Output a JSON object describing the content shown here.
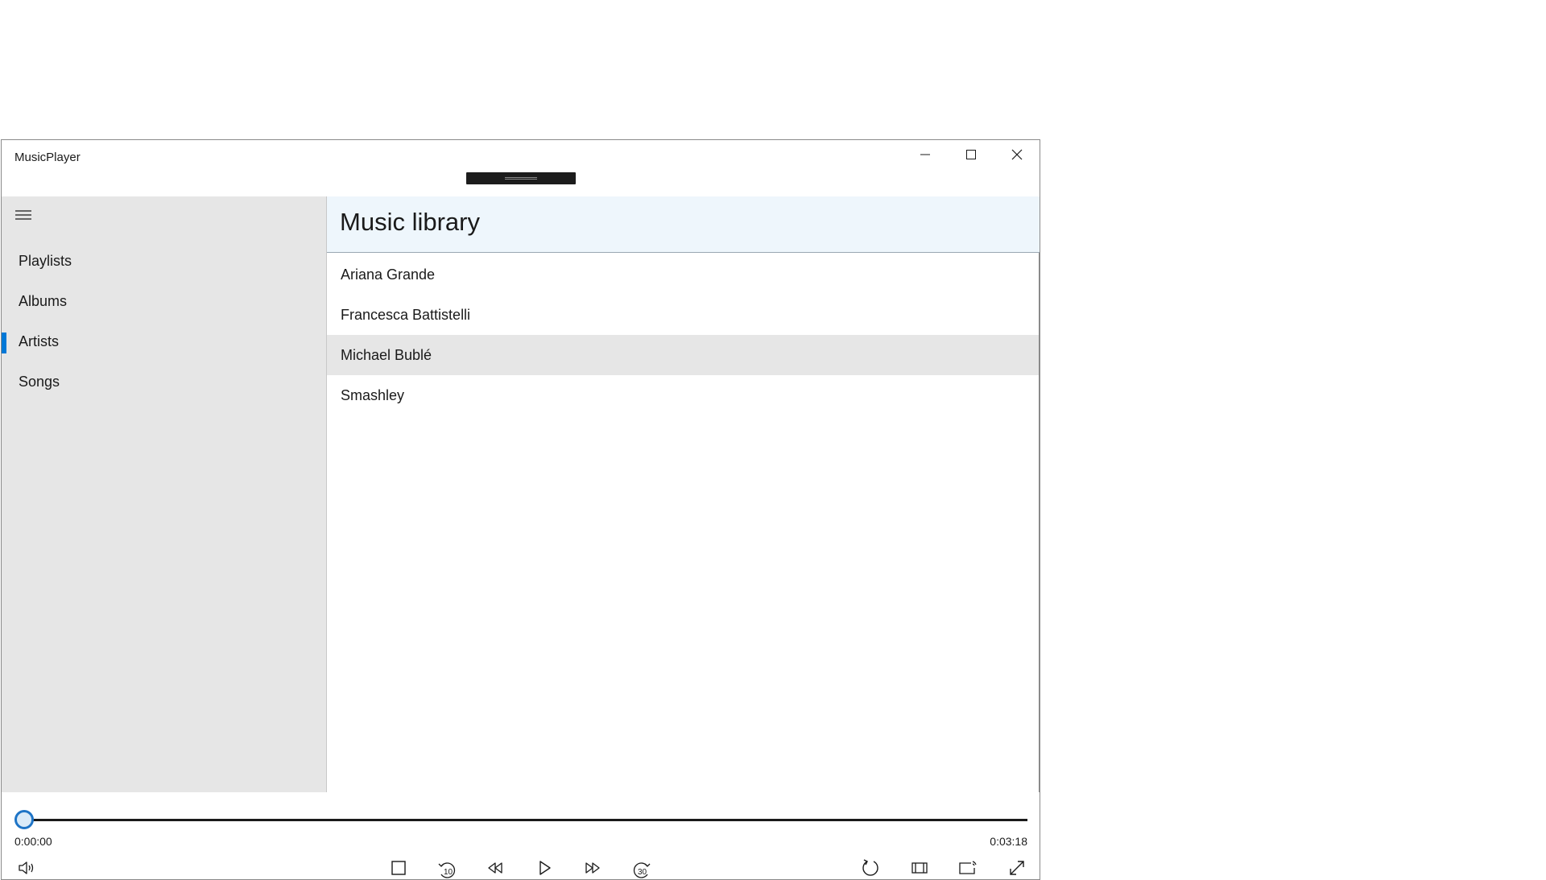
{
  "window": {
    "title": "MusicPlayer"
  },
  "titlebar": {
    "buttons": [
      "minimize-icon",
      "maximize-icon",
      "close-icon"
    ]
  },
  "sidebar": {
    "menu_icon": "hamburger-icon",
    "items": [
      {
        "label": "Playlists",
        "selected": false
      },
      {
        "label": "Albums",
        "selected": false
      },
      {
        "label": "Artists",
        "selected": true
      },
      {
        "label": "Songs",
        "selected": false
      }
    ],
    "accent_color": "#0078d7"
  },
  "main": {
    "title": "Music library",
    "list": [
      {
        "label": "Ariana Grande",
        "hover": false
      },
      {
        "label": "Francesca Battistelli",
        "hover": false
      },
      {
        "label": "Michael Bublé",
        "hover": true
      },
      {
        "label": "Smashley",
        "hover": false
      }
    ]
  },
  "player": {
    "position": "0:00:00",
    "duration": "0:03:18",
    "progress": 0,
    "controls_left": [
      "volume-icon"
    ],
    "controls_center": [
      "stop-icon",
      "skip-back-10-icon",
      "rewind-icon",
      "play-icon",
      "fast-forward-icon",
      "skip-forward-30-icon"
    ],
    "controls_right": [
      "repeat-icon",
      "aspect-ratio-icon",
      "cast-icon",
      "fullscreen-icon"
    ],
    "skip_back_label": "10",
    "skip_forward_label": "30"
  }
}
